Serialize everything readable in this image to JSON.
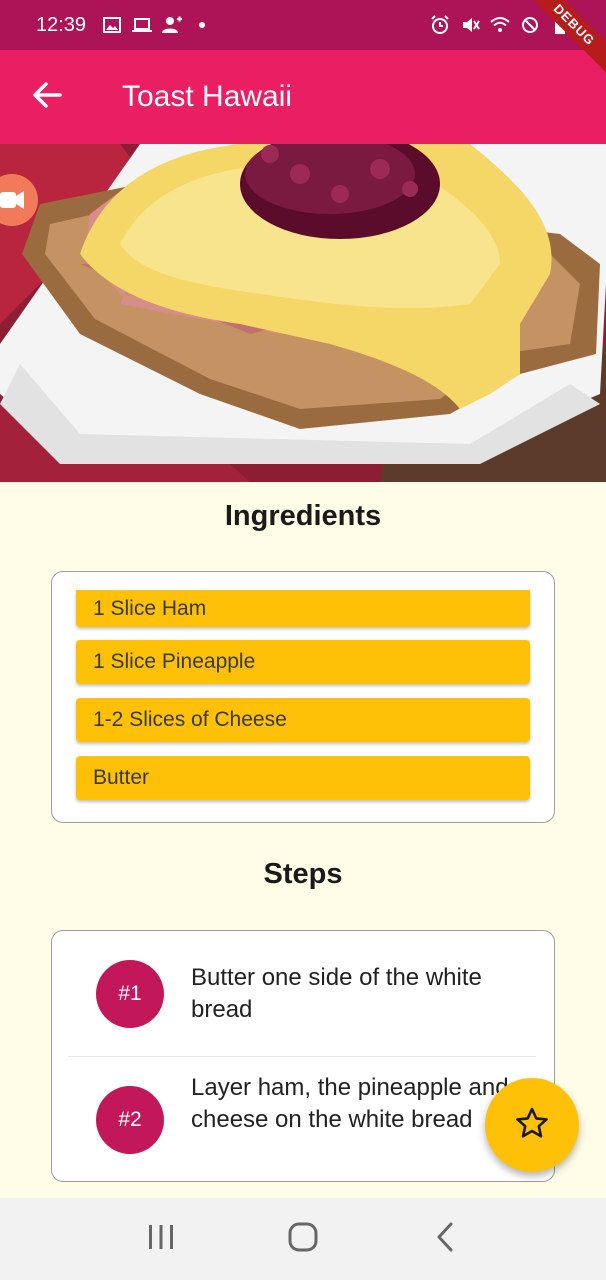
{
  "status_bar": {
    "time": "12:39",
    "left_icons": [
      "image-icon",
      "laptop-icon",
      "person-add-icon",
      "dot-icon"
    ],
    "right_icons": [
      "alarm-icon",
      "mute-icon",
      "wifi-icon",
      "blocked-icon",
      "battery-icon"
    ]
  },
  "debug_banner": "DEBUG",
  "app_bar": {
    "title": "Toast Hawaii",
    "back_icon": "arrow-back-icon"
  },
  "hero_image": {
    "alt": "Toast Hawaii"
  },
  "ingredients": {
    "title": "Ingredients",
    "items": [
      "1 Slice Ham",
      "1 Slice Pineapple",
      "1-2 Slices of Cheese",
      "Butter"
    ]
  },
  "steps": {
    "title": "Steps",
    "items": [
      {
        "badge": "#1",
        "text": "Butter one side of the white bread"
      },
      {
        "badge": "#2",
        "text": "Layer ham, the pineapple and cheese on the white bread"
      }
    ]
  },
  "fab": {
    "icon": "star-outline-icon"
  },
  "nav_bar": {
    "icons": [
      "recent-apps-icon",
      "home-icon",
      "back-icon"
    ]
  },
  "colors": {
    "status_bar": "#ad1457",
    "app_bar": "#e91e63",
    "background": "#fffde7",
    "ingredient": "#ffc107",
    "step_badge": "#c2185b",
    "fab": "#ffc107"
  }
}
